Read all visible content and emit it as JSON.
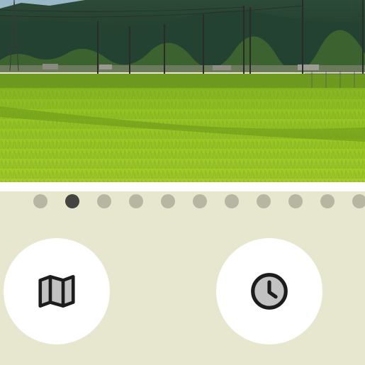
{
  "photo": {
    "subject": "rice-paddy-field",
    "colors": {
      "sky": "#8fb4c9",
      "hills": "#1f3b2c",
      "field": "#8cbc1c",
      "field_dark": "#5d8c14"
    }
  },
  "pager": {
    "count": 11,
    "active_index": 1,
    "colors": {
      "dot": "#b6b6a2",
      "active": "#444440"
    }
  },
  "actions": [
    {
      "name": "map-button",
      "icon": "map-icon"
    },
    {
      "name": "history-button",
      "icon": "clock-icon"
    }
  ],
  "theme": {
    "background": "#e7e7cf",
    "button": "#ffffff",
    "icon_fill": "#c2c2c2",
    "icon_stroke": "#1c1c1c"
  }
}
